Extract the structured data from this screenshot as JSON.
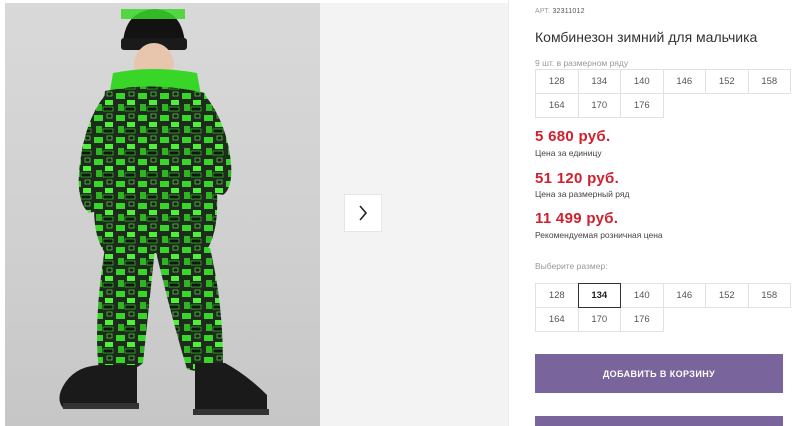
{
  "gallery": {
    "main_image_alt": "",
    "next_arrow": "chevron-right-icon"
  },
  "product": {
    "sku_label": "АРТ.",
    "sku_value": "32311012",
    "title": "Комбинезон зимний для мальчика",
    "series_caption": "9 шт. в размерном ряду",
    "series_sizes": [
      "128",
      "134",
      "140",
      "146",
      "152",
      "158",
      "164",
      "170",
      "176"
    ],
    "price_unit": "5 680 руб.",
    "price_unit_note": "Цена за единицу",
    "price_series": "51 120 руб.",
    "price_series_note": "Цена за размерный ряд",
    "price_retail": "11 499 руб.",
    "price_retail_note": "Рекомендуемая розничная цена",
    "choose_size_caption": "Выберите размер:",
    "choose_sizes": [
      "128",
      "134",
      "140",
      "146",
      "152",
      "158",
      "164",
      "170",
      "176"
    ],
    "selected_size": "134",
    "add_to_cart_label": "ДОБАВИТЬ В КОРЗИНУ"
  },
  "colors": {
    "accent": "#7a649c",
    "price": "#d0202f"
  }
}
